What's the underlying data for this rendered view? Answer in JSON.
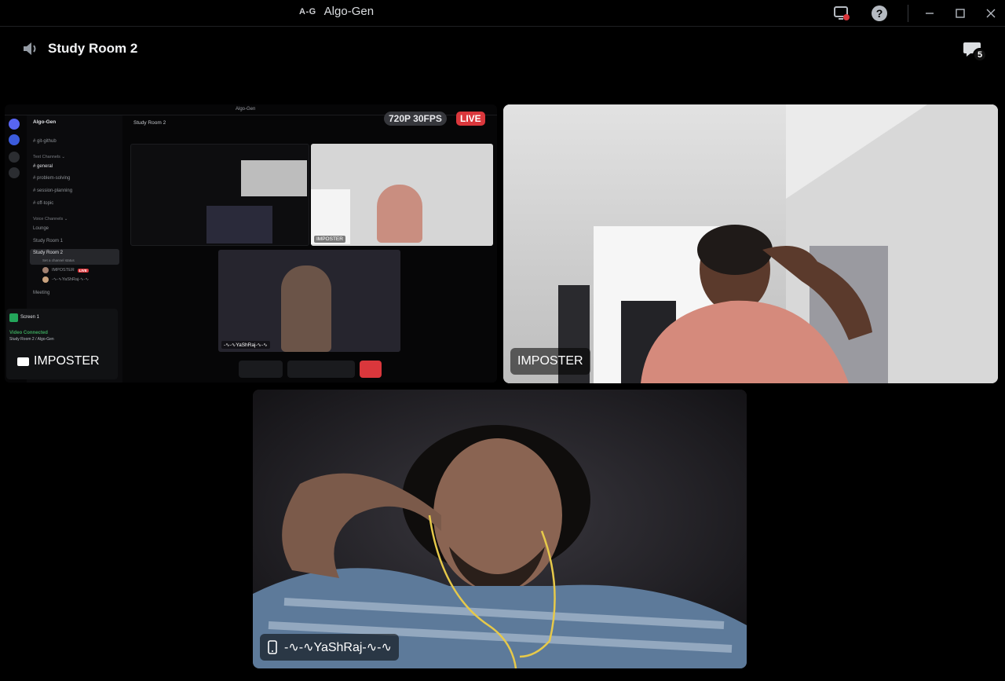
{
  "titlebar": {
    "logo": "A-G",
    "app_name": "Algo-Gen"
  },
  "header": {
    "room_title": "Study Room 2",
    "chat_badge": "5"
  },
  "screenshare": {
    "app_name": "Algo-Gen",
    "server_name": "Algo-Gen",
    "channels": [
      {
        "label": "# git-github",
        "type": "text"
      },
      {
        "label": "Text Channels ⌄",
        "type": "section"
      },
      {
        "label": "# general",
        "type": "text",
        "active": true
      },
      {
        "label": "# problem-solving",
        "type": "text"
      },
      {
        "label": "# session-planning",
        "type": "text"
      },
      {
        "label": "# off-topic",
        "type": "text"
      },
      {
        "label": "Voice Channels ⌄",
        "type": "section"
      },
      {
        "label": "Lounge",
        "type": "voice"
      },
      {
        "label": "Study Room 1",
        "type": "voice"
      },
      {
        "label": "Study Room 2",
        "type": "voice",
        "active": true
      },
      {
        "label": "Meeting",
        "type": "voice"
      }
    ],
    "status_line": "Set a channel status",
    "users": [
      {
        "name": "IMPOSTER",
        "live": "LIVE"
      },
      {
        "name": "-∿-∿YaShRaj-∿-∿"
      }
    ],
    "panel_title": "Screen 1",
    "video_connected": "Video Connected",
    "video_sub": "Study Room 2 / Algo-Gen",
    "sharer_name": "IMPOSTER",
    "main_header": "Study Room 2",
    "quality": "720P 30FPS",
    "live": "LIVE",
    "nested_imposter_label": "IMPOSTER",
    "nested_yashraj_label": "-∿-∿YaShRaj-∿-∿"
  },
  "tiles": {
    "imposter_label": "IMPOSTER",
    "yashraj_label": "-∿-∿YaShRaj-∿-∿"
  },
  "colors": {
    "background": "#000000",
    "live_red": "#da373c",
    "connected_green": "#3ba55c",
    "label_bg": "rgba(0,0,0,0.55)"
  },
  "icons": {
    "speaker": "speaker-icon",
    "screenshare_status": "screen-record-icon",
    "help": "help-icon",
    "minimize": "minimize-icon",
    "maximize": "maximize-icon",
    "close": "close-icon",
    "chat": "chat-bubble-icon",
    "phone": "phone-icon"
  }
}
